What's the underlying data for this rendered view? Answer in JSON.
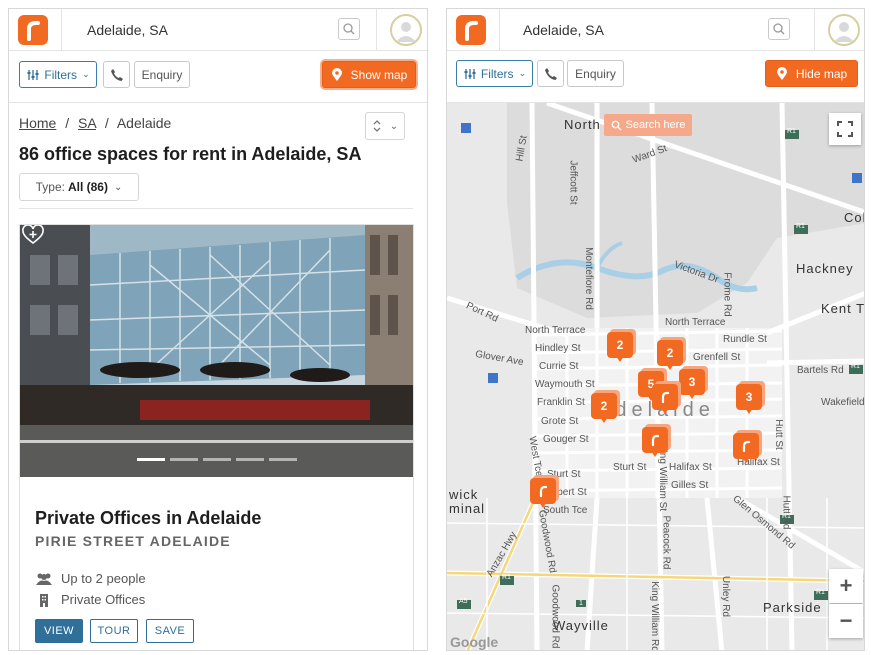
{
  "left_panel": {
    "header": {
      "location": "Adelaide, SA"
    },
    "toolbar": {
      "filters_label": "Filters",
      "enquiry_label": "Enquiry",
      "show_map_label": "Show map"
    },
    "breadcrumbs": {
      "home": "Home",
      "sep": "/",
      "state": "SA",
      "city": "Adelaide"
    },
    "title": "86 office spaces for rent in Adelaide, SA",
    "type_filter": {
      "label": "Type:",
      "value": "All (86)"
    },
    "listing": {
      "title": "Private Offices in Adelaide",
      "subtitle": "PIRIE STREET ADELAIDE",
      "capacity": "Up to 2 people",
      "space_type": "Private Offices",
      "buttons": {
        "view": "VIEW",
        "tour": "TOUR",
        "save": "SAVE"
      },
      "photo_dots": 5,
      "active_dot": 1
    }
  },
  "right_panel": {
    "header": {
      "location": "Adelaide, SA"
    },
    "toolbar": {
      "filters_label": "Filters",
      "enquiry_label": "Enquiry",
      "hide_map_label": "Hide map"
    },
    "map": {
      "search_here_label": "Search here",
      "zoom_in": "+",
      "zoom_out": "−",
      "attribution": "Google",
      "labels": {
        "north_adelaide": "North Adelaide",
        "adelaide": "Adelaide",
        "hackney": "Hackney",
        "kent_town": "Kent T",
        "parkside": "Parkside",
        "wayville": "Wayville",
        "col": "Col",
        "wick": "wick",
        "minal": "minal",
        "north_terrace": "North Terrace",
        "hindley_st": "Hindley St",
        "currie_st": "Currie St",
        "waymouth_st": "Waymouth St",
        "franklin_st": "Franklin St",
        "grote_st": "Grote St",
        "gouger_st": "Gouger St",
        "sturt_st": "Sturt St",
        "gilbert_st": "Gilbert St",
        "south_tce": "South Tce",
        "halifax_st": "Halifax St",
        "halifax_st2": "Halifax St",
        "gilles_st": "Gilles St",
        "grenfell_st": "Grenfell St",
        "rundle_st": "Rundle St",
        "bartels_rd": "Bartels Rd",
        "wakefield_st": "Wakefield",
        "victoria_dr": "Victoria Dr",
        "frome_rd": "Frome Rd",
        "montefiore_rd": "Montefiore Rd",
        "jeffcott_st": "Jeffcott St",
        "ward_st": "Ward St",
        "hill_st": "Hill St",
        "port_rd": "Port Rd",
        "glover_ave": "Glover Ave",
        "west_tce": "West Tce",
        "anzac_hwy": "Anzac Hwy",
        "goodwood_rd": "Goodwood Rd",
        "goodwood_rd2": "Goodwood Rd",
        "peacock_rd": "Peacock Rd",
        "king_william_st": "King William Rd",
        "king_william_st2": "King William St",
        "unley_rd": "Unley Rd",
        "glen_osmond_rd": "Glen Osmond Rd",
        "hutt_st": "Hutt St",
        "hutt_rd": "Hutt Rd",
        "r1_a": "R1",
        "r1_b": "R1",
        "r1_c": "R1",
        "r1_d": "R1",
        "r1_e": "R1",
        "r1_f": "R1",
        "a5": "A5",
        "m1": "1"
      },
      "markers": [
        {
          "label": "2"
        },
        {
          "label": "2"
        },
        {
          "label": "5"
        },
        {
          "label": "3"
        },
        {
          "label": "3"
        },
        {
          "label": "2"
        },
        {
          "label": ""
        },
        {
          "label": ""
        },
        {
          "label": ""
        },
        {
          "label": ""
        }
      ]
    }
  },
  "colors": {
    "brand": "#f26a22",
    "accent_blue": "#2f6f9a"
  }
}
